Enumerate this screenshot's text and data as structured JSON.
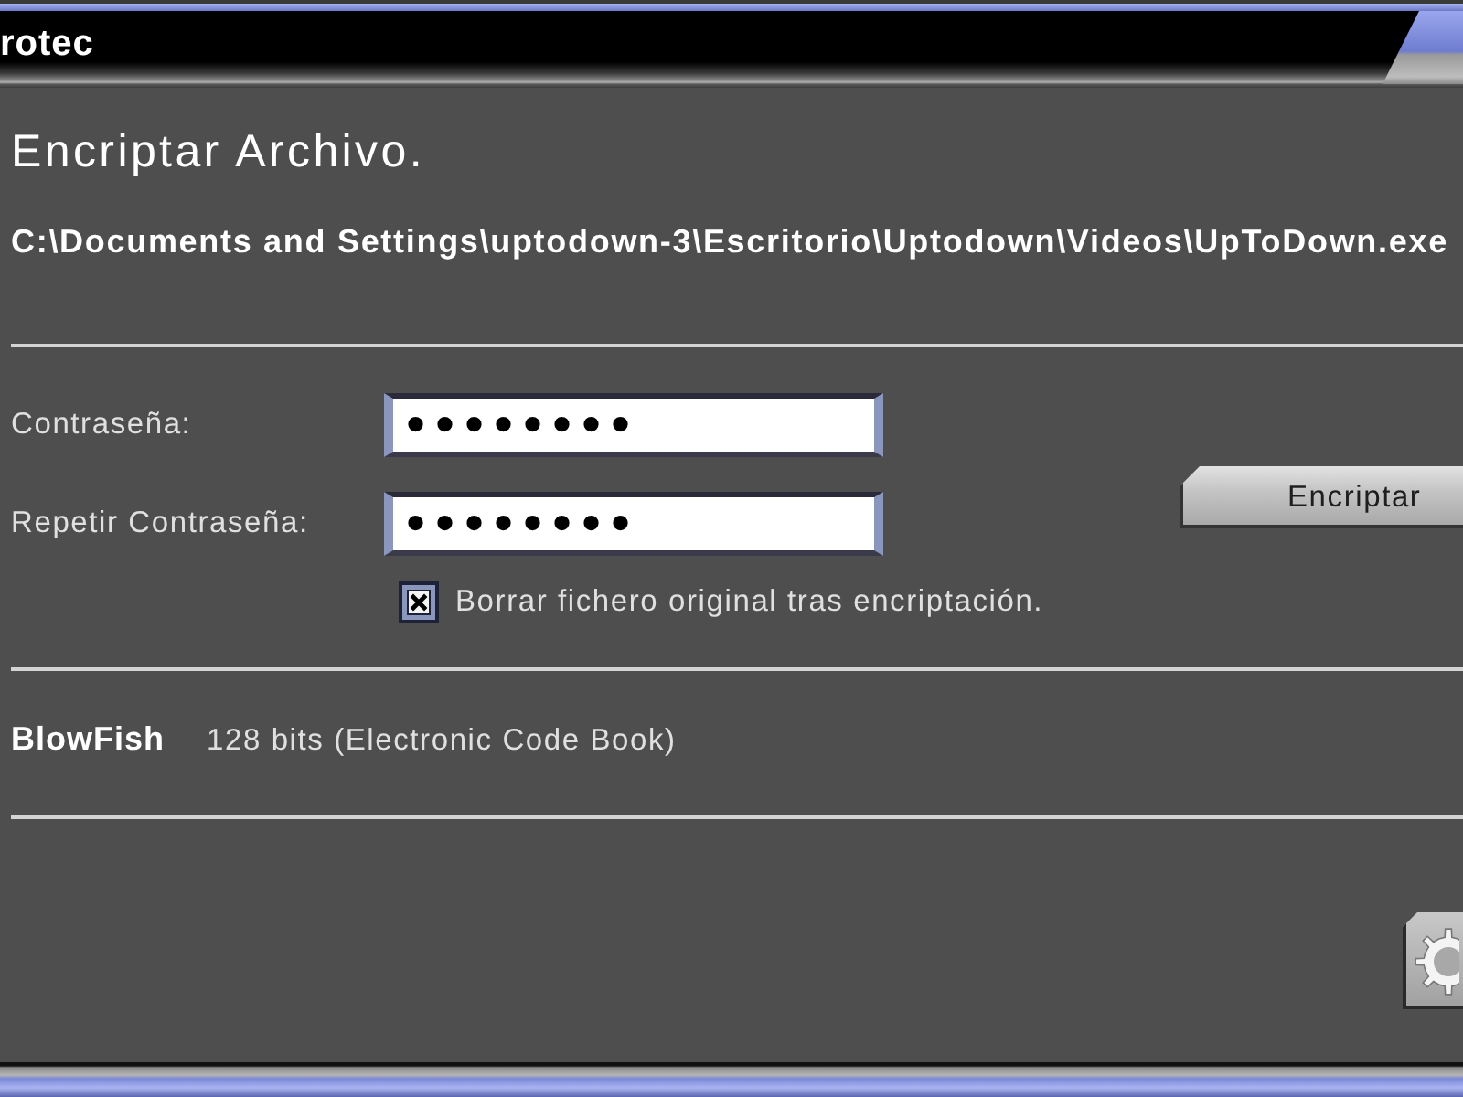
{
  "window": {
    "title": "rotec"
  },
  "heading": "Encriptar Archivo.",
  "file_path": "C:\\Documents and Settings\\uptodown-3\\Escritorio\\Uptodown\\Videos\\UpToDown.exe",
  "fields": [
    {
      "label": "Contraseña:",
      "value": "••••••••"
    },
    {
      "label": "Repetir Contraseña:",
      "value": "••••••••"
    }
  ],
  "delete_original": {
    "label": "Borrar fichero original tras encriptación.",
    "checked": true
  },
  "encrypt_button": {
    "label": "Encriptar"
  },
  "algorithm": {
    "name": "BlowFish",
    "description": "128 bits (Electronic Code Book)"
  }
}
